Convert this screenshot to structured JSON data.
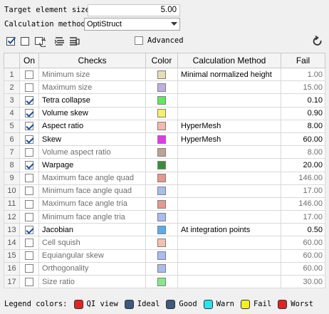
{
  "target": {
    "label": "Target element size:",
    "value": "5.00"
  },
  "calc": {
    "label": "Calculation method:",
    "value": "OptiStruct"
  },
  "toolbar": {
    "advanced_label": "Advanced",
    "advanced_checked": false
  },
  "table": {
    "headers": [
      "",
      "On",
      "Checks",
      "Color",
      "Calculation Method",
      "Fail"
    ],
    "rows": [
      {
        "n": "1",
        "on": false,
        "check": "Minimum size",
        "color": "#e8dcb4",
        "method": "Minimal normalized height",
        "fail": "1.00"
      },
      {
        "n": "2",
        "on": false,
        "check": "Maximum size",
        "color": "#c0aee0",
        "method": "",
        "fail": "15.00"
      },
      {
        "n": "3",
        "on": true,
        "check": "Tetra collapse",
        "color": "#60e860",
        "method": "",
        "fail": "0.10"
      },
      {
        "n": "4",
        "on": true,
        "check": "Volume skew",
        "color": "#f6ee74",
        "method": "",
        "fail": "0.90"
      },
      {
        "n": "5",
        "on": true,
        "check": "Aspect ratio",
        "color": "#f4b8ae",
        "method": "HyperMesh",
        "fail": "8.00"
      },
      {
        "n": "6",
        "on": true,
        "check": "Skew",
        "color": "#d840e0",
        "method": "HyperMesh",
        "fail": "60.00"
      },
      {
        "n": "7",
        "on": false,
        "check": "Volume aspect ratio",
        "color": "#c0a290",
        "method": "",
        "fail": "8.00"
      },
      {
        "n": "8",
        "on": true,
        "check": "Warpage",
        "color": "#3e8a3a",
        "method": "",
        "fail": "20.00"
      },
      {
        "n": "9",
        "on": false,
        "check": "Maximum face angle quad",
        "color": "#e49890",
        "method": "",
        "fail": "146.00"
      },
      {
        "n": "10",
        "on": false,
        "check": "Minimum face angle quad",
        "color": "#a8bcee",
        "method": "",
        "fail": "17.00"
      },
      {
        "n": "11",
        "on": false,
        "check": "Maximum face angle tria",
        "color": "#e49890",
        "method": "",
        "fail": "146.00"
      },
      {
        "n": "12",
        "on": false,
        "check": "Minimum face angle tria",
        "color": "#a8bcee",
        "method": "",
        "fail": "17.00"
      },
      {
        "n": "13",
        "on": true,
        "check": "Jacobian",
        "color": "#5aacea",
        "method": "At integration points",
        "fail": "0.50"
      },
      {
        "n": "14",
        "on": false,
        "check": "Cell squish",
        "color": "#f4c0ae",
        "method": "",
        "fail": "60.00"
      },
      {
        "n": "15",
        "on": false,
        "check": "Equiangular skew",
        "color": "#a8bcee",
        "method": "",
        "fail": "60.00"
      },
      {
        "n": "16",
        "on": false,
        "check": "Orthogonality",
        "color": "#a8bcee",
        "method": "",
        "fail": "60.00"
      },
      {
        "n": "17",
        "on": false,
        "check": "Size ratio",
        "color": "#88e888",
        "method": "",
        "fail": "30.00"
      }
    ]
  },
  "legend": {
    "label": "Legend colors:",
    "items": [
      {
        "label": "QI view",
        "color": "#e82020"
      },
      {
        "label": "Ideal",
        "color": "#3c5a80"
      },
      {
        "label": "Good",
        "color": "#3c5a80"
      },
      {
        "label": "Warn",
        "color": "#20e8f0"
      },
      {
        "label": "Fail",
        "color": "#f4f020"
      },
      {
        "label": "Worst",
        "color": "#e82020"
      }
    ]
  }
}
